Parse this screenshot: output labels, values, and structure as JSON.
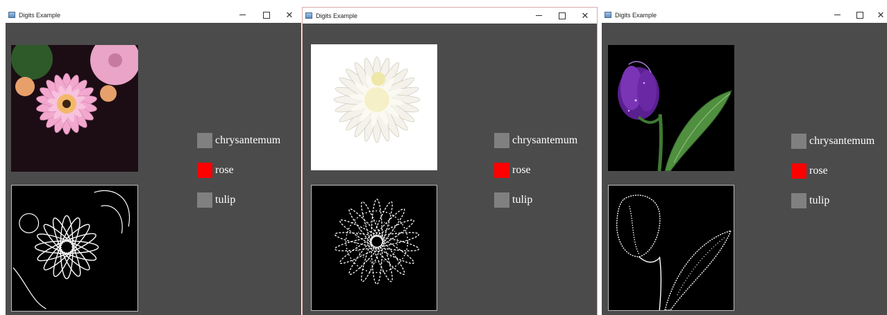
{
  "windows": [
    {
      "title": "Digits Example",
      "subject": "chrysanthemum-pink",
      "options": [
        {
          "label": "chrysantemum",
          "color": "#808080"
        },
        {
          "label": "rose",
          "color": "#ff0000"
        },
        {
          "label": "tulip",
          "color": "#808080"
        }
      ]
    },
    {
      "title": "Digits Example",
      "subject": "chrysanthemum-white",
      "options": [
        {
          "label": "chrysantemum",
          "color": "#808080"
        },
        {
          "label": "rose",
          "color": "#ff0000"
        },
        {
          "label": "tulip",
          "color": "#808080"
        }
      ]
    },
    {
      "title": "Digits Example",
      "subject": "tulip-purple",
      "options": [
        {
          "label": "chrysantemum",
          "color": "#808080"
        },
        {
          "label": "rose",
          "color": "#ff0000"
        },
        {
          "label": "tulip",
          "color": "#808080"
        }
      ]
    }
  ],
  "colors": {
    "window_bg": "#4b4b4b",
    "inactive_option": "#808080",
    "selected_option": "#ff0000"
  },
  "icons": {
    "minimize": "minimize-icon",
    "maximize": "maximize-icon",
    "close": "close-icon"
  }
}
